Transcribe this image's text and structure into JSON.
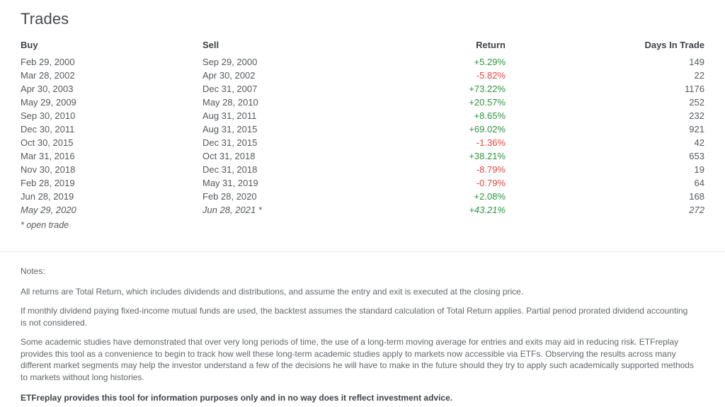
{
  "panel": {
    "title": "Trades"
  },
  "table": {
    "headers": {
      "buy": "Buy",
      "sell": "Sell",
      "return": "Return",
      "days": "Days In Trade"
    },
    "rows": [
      {
        "buy": "Feb 29, 2000",
        "sell": "Sep 29, 2000",
        "return": "+5.29%",
        "days": "149",
        "sign": "pos",
        "open": false
      },
      {
        "buy": "Mar 28, 2002",
        "sell": "Apr 30, 2002",
        "return": "-5.82%",
        "days": "22",
        "sign": "neg",
        "open": false
      },
      {
        "buy": "Apr 30, 2003",
        "sell": "Dec 31, 2007",
        "return": "+73.22%",
        "days": "1176",
        "sign": "pos",
        "open": false
      },
      {
        "buy": "May 29, 2009",
        "sell": "May 28, 2010",
        "return": "+20.57%",
        "days": "252",
        "sign": "pos",
        "open": false
      },
      {
        "buy": "Sep 30, 2010",
        "sell": "Aug 31, 2011",
        "return": "+8.65%",
        "days": "232",
        "sign": "pos",
        "open": false
      },
      {
        "buy": "Dec 30, 2011",
        "sell": "Aug 31, 2015",
        "return": "+69.02%",
        "days": "921",
        "sign": "pos",
        "open": false
      },
      {
        "buy": "Oct 30, 2015",
        "sell": "Dec 31, 2015",
        "return": "-1.36%",
        "days": "42",
        "sign": "neg",
        "open": false
      },
      {
        "buy": "Mar 31, 2016",
        "sell": "Oct 31, 2018",
        "return": "+38.21%",
        "days": "653",
        "sign": "pos",
        "open": false
      },
      {
        "buy": "Nov 30, 2018",
        "sell": "Dec 31, 2018",
        "return": "-8.79%",
        "days": "19",
        "sign": "neg",
        "open": false
      },
      {
        "buy": "Feb 28, 2019",
        "sell": "May 31, 2019",
        "return": "-0.79%",
        "days": "64",
        "sign": "neg",
        "open": false
      },
      {
        "buy": "Jun 28, 2019",
        "sell": "Feb 28, 2020",
        "return": "+2.08%",
        "days": "168",
        "sign": "pos",
        "open": false
      },
      {
        "buy": "May 29, 2020",
        "sell": "Jun 28, 2021 *",
        "return": "+43.21%",
        "days": "272",
        "sign": "pos",
        "open": true
      }
    ],
    "open_trade_note": "* open trade"
  },
  "notes": {
    "label": "Notes:",
    "paragraph_1": "All returns are Total Return, which includes dividends and distributions, and assume the entry and exit is executed at the closing price.",
    "paragraph_2": "If monthly dividend paying fixed-income mutual funds are used, the backtest assumes the standard calculation of Total Return applies. Partial period prorated dividend accounting is not considered.",
    "paragraph_3": "Some academic studies have demonstrated that over very long periods of time, the use of a long-term moving average for entries and exits may aid in reducing risk. ETFreplay provides this tool as a convenience to begin to track how well these long-term academic studies apply to markets now accessible via ETFs. Observing the results across many different market segments may help the investor understand a few of the decisions he will have to make in the future should they try to apply such academically supported methods to markets without long histories.",
    "disclaimer": "ETFreplay provides this tool for information purposes only and in no way does it reflect investment advice."
  },
  "colors": {
    "positive_return": "#2f9440",
    "negative_return": "#e8453c",
    "divider": "#e9eaea",
    "text": "#55595c",
    "heading": "#454a4d"
  }
}
